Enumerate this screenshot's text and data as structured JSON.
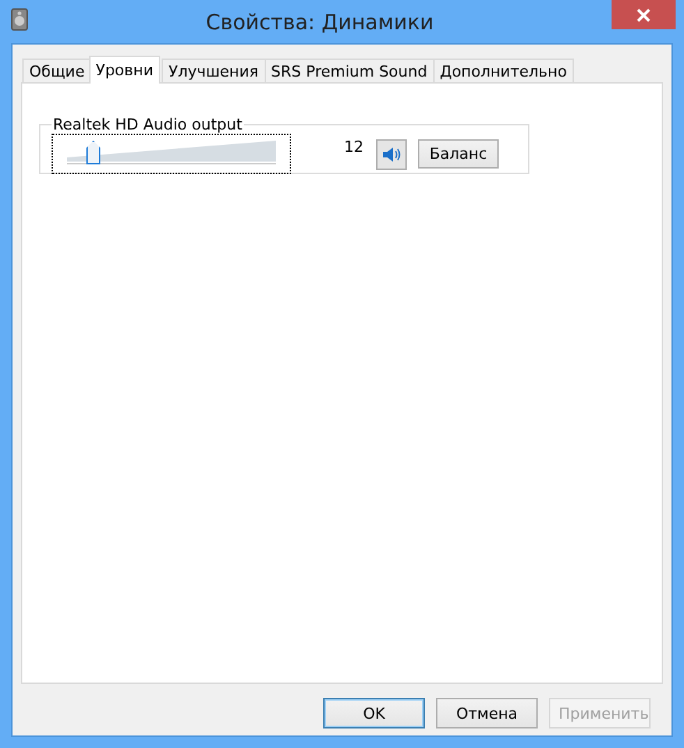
{
  "window": {
    "title": "Свойства: Динамики"
  },
  "tabs": [
    {
      "label": "Общие",
      "selected": false
    },
    {
      "label": "Уровни",
      "selected": true
    },
    {
      "label": "Улучшения",
      "selected": false
    },
    {
      "label": "SRS Premium Sound",
      "selected": false
    },
    {
      "label": "Дополнительно",
      "selected": false
    }
  ],
  "group": {
    "title": "Realtek HD Audio output",
    "level": 0.12,
    "reading": "12",
    "muted": false,
    "balance_button": "Баланс"
  },
  "buttons": [
    {
      "label": "OK",
      "default": true,
      "disabled": false
    },
    {
      "label": "Отмена",
      "default": false,
      "disabled": false
    },
    {
      "label": "Применить",
      "default": false,
      "disabled": true
    }
  ]
}
